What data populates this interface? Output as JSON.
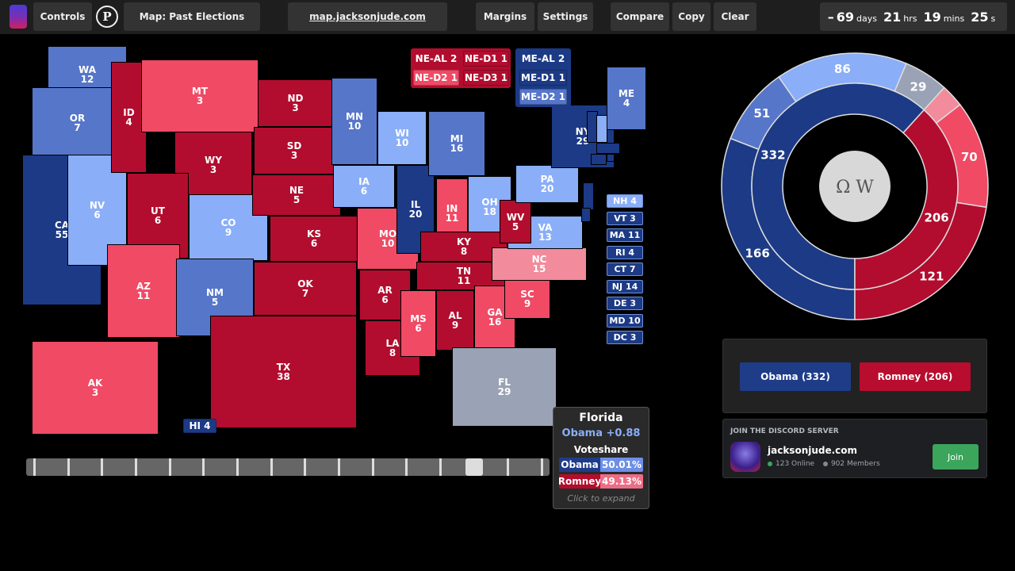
{
  "topbar": {
    "controls": "Controls",
    "p": "P",
    "map_title": "Map: Past Elections",
    "url": "map.jacksonjude.com",
    "margins": "Margins",
    "settings": "Settings",
    "compare": "Compare",
    "copy": "Copy",
    "clear": "Clear",
    "countdown": {
      "sign": "–",
      "days": "69",
      "days_u": "days",
      "hrs": "21",
      "hrs_u": "hrs",
      "mins": "19",
      "mins_u": "mins",
      "secs": "25",
      "secs_u": "s"
    }
  },
  "colors": {
    "solid_d": "#1c3a85",
    "likely_d": "#5676c9",
    "lean_d": "#8aaef7",
    "tossup": "#9aa3b5",
    "tilt_r": "#f28b9b",
    "lean_r": "#f04a65",
    "solid_r": "#b20d2e"
  },
  "states": [
    {
      "abbr": "WA",
      "ev": "12",
      "rating": "likely_d"
    },
    {
      "abbr": "OR",
      "ev": "7",
      "rating": "likely_d"
    },
    {
      "abbr": "CA",
      "ev": "55",
      "rating": "solid_d"
    },
    {
      "abbr": "NV",
      "ev": "6",
      "rating": "lean_d"
    },
    {
      "abbr": "ID",
      "ev": "4",
      "rating": "solid_r"
    },
    {
      "abbr": "MT",
      "ev": "3",
      "rating": "lean_r"
    },
    {
      "abbr": "WY",
      "ev": "3",
      "rating": "solid_r"
    },
    {
      "abbr": "UT",
      "ev": "6",
      "rating": "solid_r"
    },
    {
      "abbr": "AZ",
      "ev": "11",
      "rating": "lean_r"
    },
    {
      "abbr": "CO",
      "ev": "9",
      "rating": "lean_d"
    },
    {
      "abbr": "NM",
      "ev": "5",
      "rating": "likely_d"
    },
    {
      "abbr": "ND",
      "ev": "3",
      "rating": "solid_r"
    },
    {
      "abbr": "SD",
      "ev": "3",
      "rating": "solid_r"
    },
    {
      "abbr": "NE",
      "ev": "5",
      "rating": "solid_r"
    },
    {
      "abbr": "KS",
      "ev": "6",
      "rating": "solid_r"
    },
    {
      "abbr": "OK",
      "ev": "7",
      "rating": "solid_r"
    },
    {
      "abbr": "TX",
      "ev": "38",
      "rating": "solid_r"
    },
    {
      "abbr": "MN",
      "ev": "10",
      "rating": "likely_d"
    },
    {
      "abbr": "IA",
      "ev": "6",
      "rating": "lean_d"
    },
    {
      "abbr": "MO",
      "ev": "10",
      "rating": "lean_r"
    },
    {
      "abbr": "AR",
      "ev": "6",
      "rating": "solid_r"
    },
    {
      "abbr": "LA",
      "ev": "8",
      "rating": "solid_r"
    },
    {
      "abbr": "WI",
      "ev": "10",
      "rating": "lean_d"
    },
    {
      "abbr": "IL",
      "ev": "20",
      "rating": "solid_d"
    },
    {
      "abbr": "MI",
      "ev": "16",
      "rating": "likely_d"
    },
    {
      "abbr": "IN",
      "ev": "11",
      "rating": "lean_r"
    },
    {
      "abbr": "OH",
      "ev": "18",
      "rating": "lean_d"
    },
    {
      "abbr": "KY",
      "ev": "8",
      "rating": "solid_r"
    },
    {
      "abbr": "TN",
      "ev": "11",
      "rating": "solid_r"
    },
    {
      "abbr": "MS",
      "ev": "6",
      "rating": "lean_r"
    },
    {
      "abbr": "AL",
      "ev": "9",
      "rating": "solid_r"
    },
    {
      "abbr": "GA",
      "ev": "16",
      "rating": "lean_r"
    },
    {
      "abbr": "FL",
      "ev": "29",
      "rating": "tossup"
    },
    {
      "abbr": "SC",
      "ev": "9",
      "rating": "lean_r"
    },
    {
      "abbr": "NC",
      "ev": "15",
      "rating": "tilt_r"
    },
    {
      "abbr": "VA",
      "ev": "13",
      "rating": "lean_d"
    },
    {
      "abbr": "WV",
      "ev": "5",
      "rating": "solid_r"
    },
    {
      "abbr": "PA",
      "ev": "20",
      "rating": "lean_d"
    },
    {
      "abbr": "NY",
      "ev": "29",
      "rating": "solid_d"
    },
    {
      "abbr": "ME",
      "ev": "4",
      "rating": "likely_d"
    },
    {
      "abbr": "AK",
      "ev": "3",
      "rating": "lean_r"
    }
  ],
  "hawaii": {
    "label": "HI 4",
    "rating": "solid_d"
  },
  "small_states": [
    {
      "label": "NH 4",
      "rating": "lean_d"
    },
    {
      "label": "VT 3",
      "rating": "solid_d"
    },
    {
      "label": "MA 11",
      "rating": "solid_d"
    },
    {
      "label": "RI 4",
      "rating": "solid_d"
    },
    {
      "label": "CT 7",
      "rating": "solid_d"
    },
    {
      "label": "NJ 14",
      "rating": "solid_d"
    },
    {
      "label": "DE 3",
      "rating": "solid_d"
    },
    {
      "label": "MD 10",
      "rating": "solid_d"
    },
    {
      "label": "DC 3",
      "rating": "solid_d"
    }
  ],
  "nebraska_districts": [
    {
      "label": "NE-AL 2",
      "rating": "solid_r"
    },
    {
      "label": "NE-D1 1",
      "rating": "solid_r"
    },
    {
      "label": "NE-D2 1",
      "rating": "lean_r"
    },
    {
      "label": "NE-D3 1",
      "rating": "solid_r"
    }
  ],
  "maine_districts": [
    {
      "label": "ME-AL 2",
      "rating": "solid_d"
    },
    {
      "label": "ME-D1 1",
      "rating": "solid_d"
    },
    {
      "label": "ME-D2 1",
      "rating": "likely_d"
    }
  ],
  "timeline": {
    "ticks": 16,
    "position_index": 13
  },
  "tooltip": {
    "state": "Florida",
    "margin": "Obama +0.88",
    "voteshare_label": "Voteshare",
    "rows": [
      {
        "name": "Obama",
        "pct": "50.01%"
      },
      {
        "name": "Romney",
        "pct": "49.13%"
      }
    ],
    "hint": "Click to expand"
  },
  "chart_data": {
    "type": "pie",
    "center_icon": "wikipedia-globe-icon",
    "outer": [
      {
        "value": 166,
        "rating": "solid_d"
      },
      {
        "value": 51,
        "rating": "likely_d"
      },
      {
        "value": 86,
        "rating": "lean_d"
      },
      {
        "value": 29,
        "rating": "tossup"
      },
      {
        "value": 15,
        "rating": "tilt_r",
        "label_hidden": true
      },
      {
        "value": 70,
        "rating": "lean_r"
      },
      {
        "value": 121,
        "rating": "solid_r"
      }
    ],
    "inner": [
      {
        "value": 332,
        "rating": "solid_d"
      },
      {
        "value": 206,
        "rating": "solid_r"
      }
    ]
  },
  "candidates": [
    {
      "label": "Obama (332)",
      "color": "#1f3c88"
    },
    {
      "label": "Romney (206)",
      "color": "#b80d2e"
    }
  ],
  "discord": {
    "header": "JOIN THE DISCORD SERVER",
    "name": "jacksonjude.com",
    "online": "123 Online",
    "members": "902 Members",
    "join": "Join"
  }
}
